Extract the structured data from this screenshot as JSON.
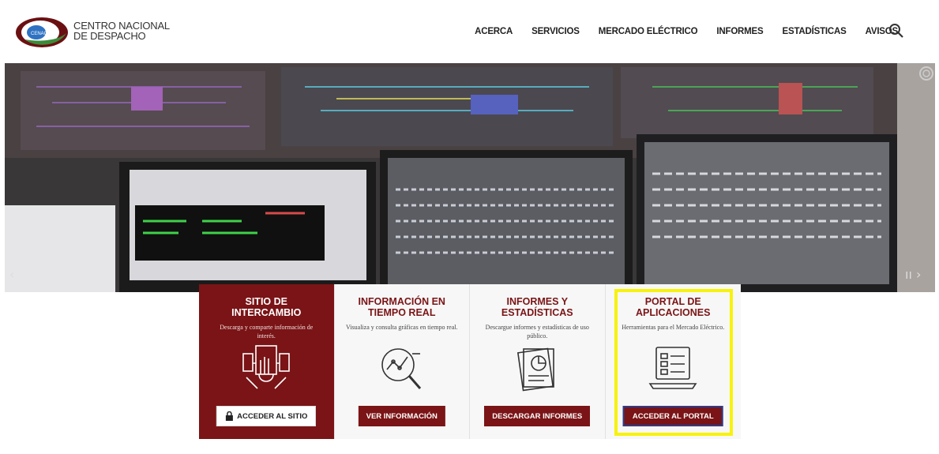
{
  "header": {
    "logo_line1": "CENTRO NACIONAL",
    "logo_line2": "DE DESPACHO",
    "nav": [
      {
        "label": "ACERCA"
      },
      {
        "label": "SERVICIOS"
      },
      {
        "label": "MERCADO ELÉCTRICO"
      },
      {
        "label": "INFORMES"
      },
      {
        "label": "ESTADÍSTICAS"
      },
      {
        "label": "AVISOS"
      }
    ]
  },
  "cards": [
    {
      "title": "SITIO DE INTERCAMBIO",
      "desc": "Descarga y comparte información de interés.",
      "button": "ACCEDER AL SITIO"
    },
    {
      "title": "INFORMACIÓN EN TIEMPO REAL",
      "desc": "Visualiza y consulta gráficas en tiempo real.",
      "button": "VER INFORMACIÓN"
    },
    {
      "title": "INFORMES Y ESTADÍSTICAS",
      "desc": "Descargue informes y estadísticas de uso público.",
      "button": "DESCARGAR INFORMES"
    },
    {
      "title": "PORTAL DE APLICACIONES",
      "desc": "Herramientas para el Mercado Eléctrico.",
      "button": "ACCEDER AL PORTAL"
    }
  ],
  "colors": {
    "brand": "#7a1416",
    "highlight": "#f7f20c",
    "accent_blue": "#2d3b8b"
  }
}
